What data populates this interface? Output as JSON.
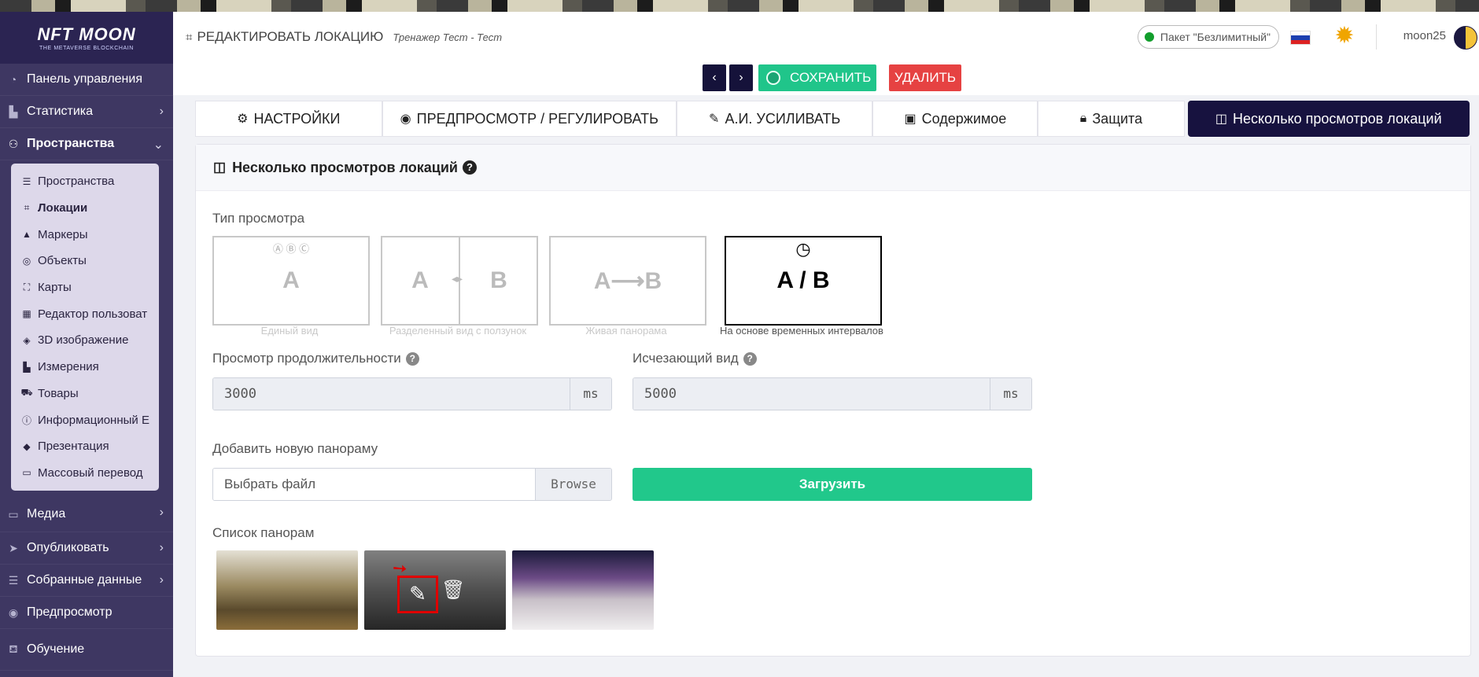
{
  "sidebar": {
    "logo_main": "NFT MOON",
    "logo_sub": "THE METAVERSE BLOCKCHAIN",
    "items_top": [
      {
        "label": "Панель управления",
        "icon": "dashboard-icon"
      },
      {
        "label": "Статистика",
        "icon": "chart-icon"
      },
      {
        "label": "Пространства",
        "icon": "spaces-icon"
      }
    ],
    "submenu": [
      {
        "label": "Пространства",
        "icon": "list-icon"
      },
      {
        "label": "Локации",
        "icon": "location-icon"
      },
      {
        "label": "Маркеры",
        "icon": "marker-icon"
      },
      {
        "label": "Объекты",
        "icon": "object-icon"
      },
      {
        "label": "Карты",
        "icon": "map-icon"
      },
      {
        "label": "Редактор пользоват",
        "icon": "editor-icon"
      },
      {
        "label": "3D изображение",
        "icon": "cube-icon"
      },
      {
        "label": "Измерения",
        "icon": "ruler-icon"
      },
      {
        "label": "Товары",
        "icon": "cart-icon"
      },
      {
        "label": "Информационный Е",
        "icon": "info-icon"
      },
      {
        "label": "Презентация",
        "icon": "presentation-icon"
      },
      {
        "label": "Массовый перевод",
        "icon": "translate-icon"
      }
    ],
    "items_bottom": [
      {
        "label": "Медиа",
        "icon": "media-icon"
      },
      {
        "label": "Опубликовать",
        "icon": "publish-icon"
      },
      {
        "label": "Собранные данные",
        "icon": "data-icon"
      },
      {
        "label": "Предпросмотр",
        "icon": "eye-icon"
      },
      {
        "label": "Обучение",
        "icon": "training-icon"
      }
    ]
  },
  "header": {
    "title": "РЕДАКТИРОВАТЬ ЛОКАЦИЮ",
    "subtitle": "Тренажер Тест - Тест",
    "package": "Пакет \"Безлимитный\"",
    "username": "moon25"
  },
  "toolbar": {
    "prev_label": "‹",
    "next_label": "›",
    "save_label": "СОХРАНИТЬ",
    "delete_label": "УДАЛИТЬ"
  },
  "tabs": [
    {
      "label": "НАСТРОЙКИ",
      "icon": "gears-icon"
    },
    {
      "label": "ПРЕДПРОСМОТР / РЕГУЛИРОВАТЬ",
      "icon": "eye-icon"
    },
    {
      "label": "А.И. УСИЛИВАТЬ",
      "icon": "magic-broom-icon"
    },
    {
      "label": "Содержимое",
      "icon": "images-icon"
    },
    {
      "label": "Защита",
      "icon": "lock-icon"
    },
    {
      "label": "Несколько просмотров локаций",
      "icon": "columns-icon"
    }
  ],
  "card": {
    "title": "Несколько просмотров локаций",
    "view_type_label": "Тип просмотра",
    "view_types": [
      {
        "big": "A",
        "caption": "Единый вид",
        "extra": "Ⓐ Ⓑ Ⓒ"
      },
      {
        "big_left": "A",
        "big_right": "B",
        "caption": "Разделенный вид с ползунок"
      },
      {
        "big": "A⟶B",
        "caption": "Живая панорама"
      },
      {
        "big": "A / B",
        "caption": "На основе временных интервалов"
      }
    ],
    "duration_label": "Просмотр продолжительности",
    "duration_value": "3000",
    "duration_unit": "ms",
    "fade_label": "Исчезающий вид",
    "fade_value": "5000",
    "fade_unit": "ms",
    "add_pano_label": "Добавить новую панораму",
    "file_placeholder": "Выбрать файл",
    "browse_label": "Browse",
    "upload_label": "Загрузить",
    "pano_list_label": "Список панорам"
  }
}
